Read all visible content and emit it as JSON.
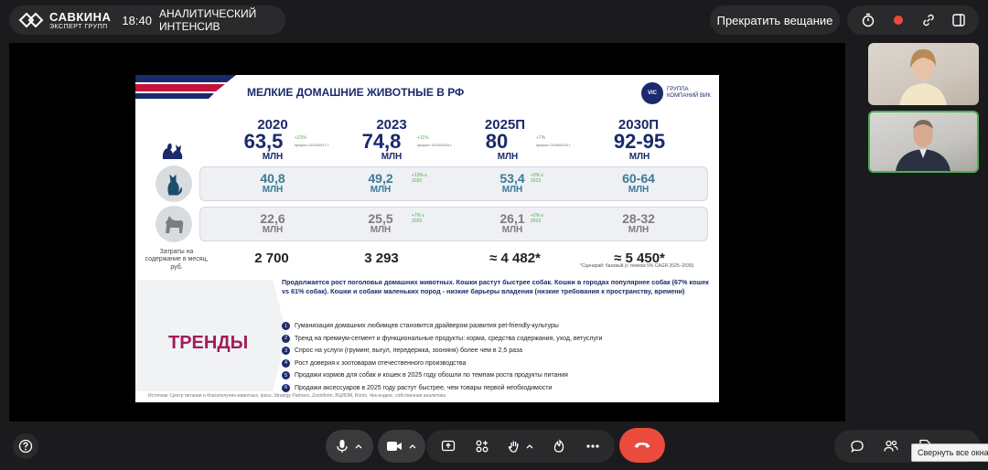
{
  "brand": {
    "name": "САВКИНА",
    "sub": "ЭКСПЕРТ ГРУПП",
    "time": "18:40",
    "title": "АНАЛИТИЧЕСКИЙ ИНТЕНСИВ"
  },
  "header": {
    "stop_label": "Прекратить вещание"
  },
  "icons": {
    "top": [
      "timer-icon",
      "record-icon",
      "link-icon",
      "layout-icon"
    ],
    "bottom": [
      "help-icon",
      "mic-icon",
      "camera-icon",
      "share-screen-icon",
      "apps-icon",
      "raise-hand-icon",
      "reaction-icon",
      "more-icon",
      "hangup-icon",
      "chat-icon",
      "participants-icon",
      "notes-icon"
    ]
  },
  "colors": {
    "end_call": "#ea4b3c",
    "active_speaker": "#4caf50",
    "slide_navy": "#1a2a6c",
    "trend_magenta": "#a01e5a"
  },
  "tooltip": "Свернуть все окна",
  "slide": {
    "title": "МЕЛКИЕ ДОМАШНИЕ ЖИВОТНЫЕ В РФ",
    "logo": {
      "badge": "VIC",
      "text": "ГРУППА КОМПАНИЙ ВИК"
    },
    "unit": "МЛН",
    "years": [
      {
        "year": "2020",
        "total": "63,5",
        "growth": "+23%",
        "basis": "прирост 2020/2017 г.",
        "cats": "40,8",
        "cats_growth": "",
        "dogs": "22,6",
        "dogs_growth": "",
        "cost": "2 700"
      },
      {
        "year": "2023",
        "total": "74,8",
        "growth": "+11%",
        "basis": "прирост 2023/2020 г.",
        "cats": "49,2",
        "cats_growth": "+13% к 2020",
        "dogs": "25,5",
        "dogs_growth": "+7% к 2020",
        "cost": "3 293"
      },
      {
        "year": "2025П",
        "total": "80",
        "growth": "+7%",
        "basis": "прирост 2025/2023 г.",
        "cats": "53,4",
        "cats_growth": "+9% к 2023",
        "dogs": "26,1",
        "dogs_growth": "+2% к 2023",
        "cost": "≈ 4 482*"
      },
      {
        "year": "2030П",
        "total": "92-95",
        "growth": "",
        "basis": "",
        "cats": "60-64",
        "cats_growth": "",
        "dogs": "28-32",
        "dogs_growth": "",
        "cost": "≈ 5 450*"
      }
    ],
    "cost_label": "Затраты на содержание в месяц, руб.",
    "scenario": "*Сценарий: базовый (с темпом 5% CAGR 2025–2030)",
    "trends_word": "ТРЕНДЫ",
    "lead": "Продолжается рост поголовья домашних животных. Кошки растут быстрее собак. Кошки в городах популярнее собак (67% кошек vs 61% собак). Кошки и собаки маленьких пород - низкие барьеры владения (низкие требования к пространству, времени)",
    "trends": [
      {
        "n": "1",
        "text": "Гуманизация домашних любимцев становится драйвером развития pet-friendly-культуры"
      },
      {
        "n": "2",
        "text": "Тренд на премиум-сегмент и функциональные продукты: корма, средства содержания, уход, ветуслуги"
      },
      {
        "n": "3",
        "text": "Спрос на услуги (груминг, выгул, передержка, зооняня) более чем в 2,5 раза"
      },
      {
        "n": "4",
        "text": "Рост доверия к зоотоварам отечественного производства"
      },
      {
        "n": "5",
        "text": "Продажи кормов для собак и кошек в 2025 году обошли по темпам роста продукты питания"
      },
      {
        "n": "6",
        "text": "Продажи аксессуаров в 2025 году растут быстрее, чем товары первой необходимости"
      }
    ],
    "source": "Источник: Центр питания и благополучия животных, Ipsos, Strategy Partners, Zooinform, ВЦИОМ, Romir, Чек индекс, собственная аналитика"
  }
}
